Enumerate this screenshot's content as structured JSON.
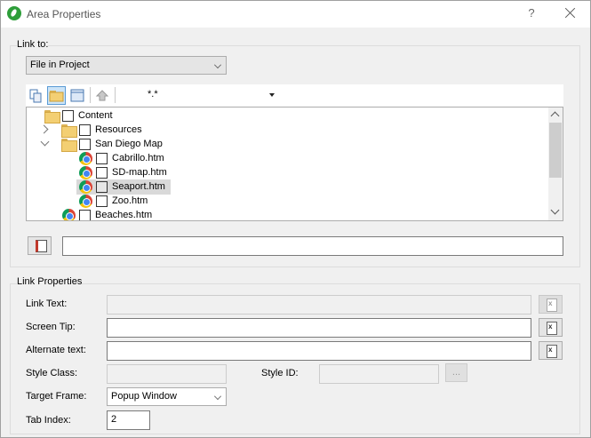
{
  "window": {
    "title": "Area Properties",
    "help_glyph": "?",
    "close_icon": "close-icon"
  },
  "link_to": {
    "group_label": "Link to:",
    "source_value": "File in Project",
    "toolbar": {
      "buttons": [
        "copy-icon",
        "folder-view-icon",
        "list-view-icon",
        "up-level-icon"
      ],
      "active_button": "folder-view-icon",
      "filter_value": "*.*"
    },
    "tree": [
      {
        "label": "Content",
        "type": "folder",
        "expander": "none",
        "checked": false
      },
      {
        "label": "Resources",
        "type": "folder",
        "expander": "collapsed",
        "checked": false
      },
      {
        "label": "San Diego Map",
        "type": "folder",
        "expander": "expanded",
        "checked": false
      },
      {
        "label": "Cabrillo.htm",
        "type": "chrome-file",
        "checked": false
      },
      {
        "label": "SD-map.htm",
        "type": "chrome-file",
        "checked": false
      },
      {
        "label": "Seaport.htm",
        "type": "chrome-file",
        "checked": false,
        "selected": true
      },
      {
        "label": "Zoo.htm",
        "type": "chrome-file",
        "checked": false
      },
      {
        "label": "Beaches.htm",
        "type": "chrome-file",
        "checked": false
      }
    ],
    "path_value": ""
  },
  "link_properties": {
    "group_label": "Link Properties",
    "link_text_label": "Link Text:",
    "link_text_value": "",
    "screen_tip_label": "Screen Tip:",
    "screen_tip_value": "",
    "alternate_text_label": "Alternate text:",
    "alternate_text_value": "",
    "style_class_label": "Style Class:",
    "style_class_value": "",
    "style_id_label": "Style ID:",
    "style_id_value": "",
    "ellipsis_label": "...",
    "target_frame_label": "Target Frame:",
    "target_frame_value": "Popup Window",
    "tab_index_label": "Tab Index:",
    "tab_index_value": "2"
  },
  "colors": {
    "accent": "#5a9bd5",
    "selection": "#d9d9d9",
    "app_icon": "#2e9e3a"
  }
}
